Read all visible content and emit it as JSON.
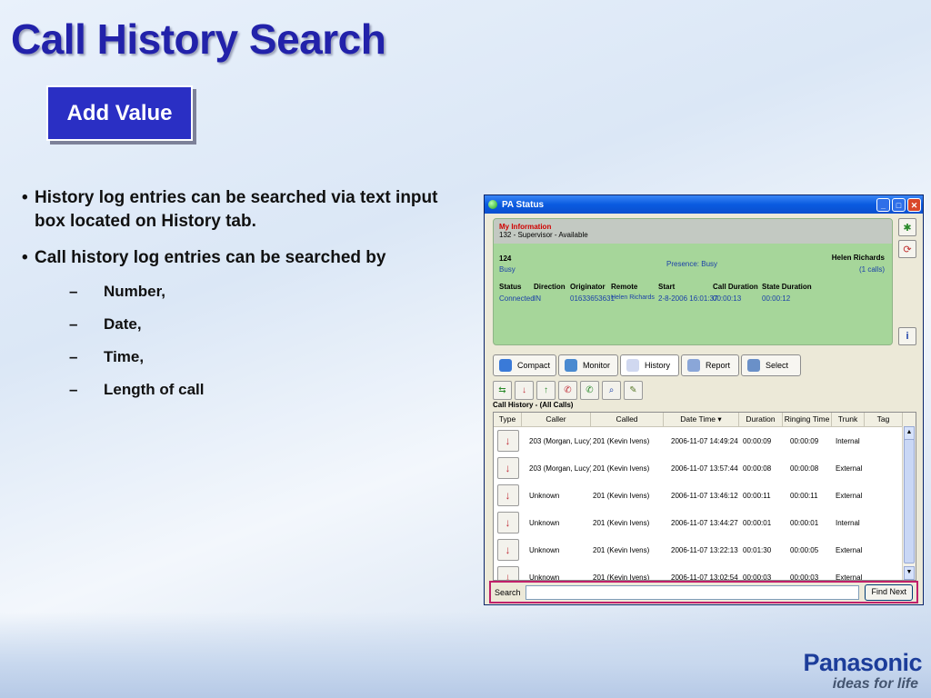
{
  "slide": {
    "title": "Call History Search",
    "badge": "Add Value",
    "bullets": [
      "History log entries can be searched via text input box located on History tab.",
      "Call history log entries can be searched by"
    ],
    "bullet_marker": "•",
    "sub_marker": "–",
    "sub_items": [
      "Number,",
      "Date,",
      "Time,",
      "Length of call"
    ]
  },
  "window": {
    "title": "PA Status",
    "controls": {
      "minimize": "_",
      "maximize": "□",
      "close": "✕"
    },
    "info": {
      "heading": "My Information",
      "subheading": "132 - Supervisor - Available",
      "ext": "124",
      "ext_status": "Busy",
      "presence": "Presence:  Busy",
      "user": "Helen Richards",
      "calls": "(1 calls)",
      "columns": [
        "Status",
        "Direction",
        "Originator",
        "Remote",
        "Start",
        "Call Duration",
        "State Duration"
      ],
      "values": [
        "Connected",
        "IN",
        "01633653631",
        "Helen Richards",
        "2-8-2006 16:01:37",
        "00:00:13",
        "00:00:12"
      ]
    },
    "tabs": [
      "Compact",
      "Monitor",
      "History",
      "Report",
      "Select"
    ],
    "list_title": "Call History - (All Calls)",
    "grid": {
      "headers": [
        "Type",
        "Caller",
        "Called",
        "Date Time",
        "Duration",
        "Ringing Time",
        "Trunk",
        "Tag"
      ],
      "rows": [
        [
          "203 (Morgan, Lucy)",
          "201 (Kevin Ivens)",
          "2006-11-07 14:49:24",
          "00:00:09",
          "00:00:09",
          "Internal"
        ],
        [
          "203 (Morgan, Lucy)",
          "201 (Kevin Ivens)",
          "2006-11-07 13:57:44",
          "00:00:08",
          "00:00:08",
          "External"
        ],
        [
          "Unknown",
          "201 (Kevin Ivens)",
          "2006-11-07 13:46:12",
          "00:00:11",
          "00:00:11",
          "External"
        ],
        [
          "Unknown",
          "201 (Kevin Ivens)",
          "2006-11-07 13:44:27",
          "00:00:01",
          "00:00:01",
          "Internal"
        ],
        [
          "Unknown",
          "201 (Kevin Ivens)",
          "2006-11-07 13:22:13",
          "00:01:30",
          "00:00:05",
          "External"
        ],
        [
          "Unknown",
          "201 (Kevin Ivens)",
          "2006-11-07 13:02:54",
          "00:00:03",
          "00:00:03",
          "External"
        ]
      ]
    },
    "search": {
      "label": "Search",
      "value": "",
      "button": "Find Next"
    }
  },
  "logo": {
    "brand": "Panasonic",
    "tagline": "ideas for life"
  },
  "colors": {
    "title": "#2222aa",
    "badge": "#2a2fc4",
    "highlight": "#c0206a",
    "info_panel": "#a6d69a"
  }
}
